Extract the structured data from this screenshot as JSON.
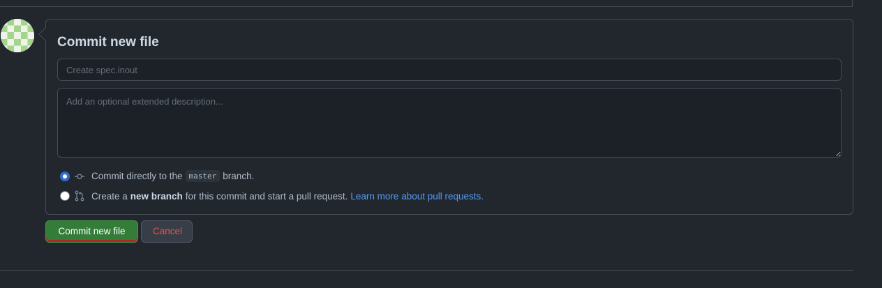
{
  "commit_form": {
    "title": "Commit new file",
    "summary_placeholder": "Create spec.inout",
    "description_placeholder": "Add an optional extended description...",
    "option_direct": {
      "prefix": "Commit directly to the",
      "branch": "master",
      "suffix": "branch.",
      "selected": true,
      "icon": "git-commit-icon"
    },
    "option_new_branch": {
      "prefix": "Create a",
      "emphasis": "new branch",
      "suffix": "for this commit and start a pull request.",
      "link": "Learn more about pull requests.",
      "selected": false,
      "icon": "git-pull-request-icon"
    }
  },
  "actions": {
    "commit_label": "Commit new file",
    "cancel_label": "Cancel"
  },
  "colors": {
    "background": "#22272e",
    "commit_button": "#347d39",
    "cancel_text": "#e5534b",
    "link": "#539bf5",
    "radio_accent": "#316dca"
  }
}
